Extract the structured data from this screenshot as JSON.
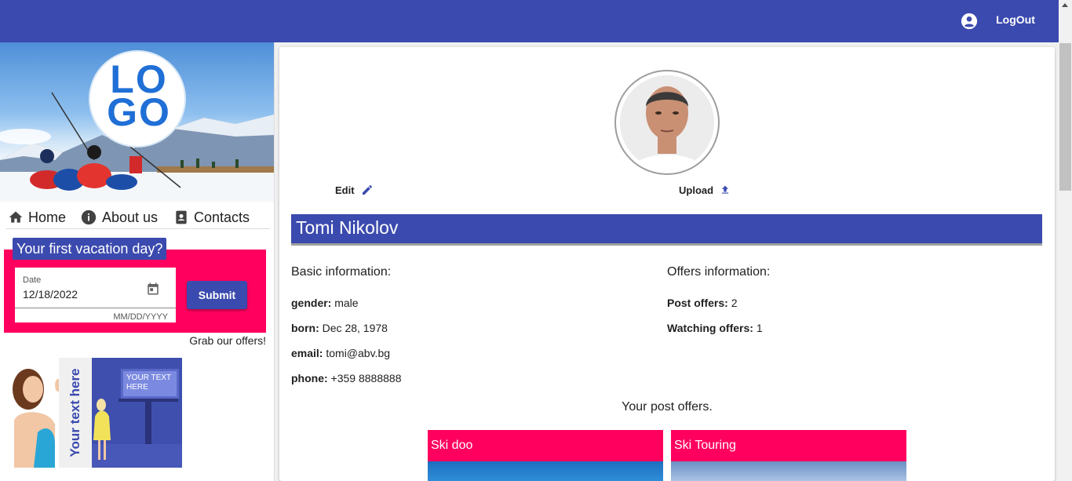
{
  "header": {
    "account_icon": "account-circle-icon",
    "logout_label": "LogOut",
    "bar_color": "#3b4aae"
  },
  "sidebar": {
    "logo_text": "LOGO",
    "nav": [
      {
        "label": "Home",
        "icon": "home-icon"
      },
      {
        "label": "About us",
        "icon": "info-icon"
      },
      {
        "label": "Contacts",
        "icon": "contacts-icon"
      }
    ],
    "vacation": {
      "title": "Your first vacation day?",
      "date_label": "Date",
      "date_value": "12/18/2022",
      "date_hint": "MM/DD/YYYY",
      "submit_label": "Submit",
      "accent_color": "#ff005e"
    },
    "grab_offers": "Grab our offers!",
    "ad": {
      "vertical_text": "Your text here",
      "board_text": "YOUR TEXT HERE"
    }
  },
  "profile": {
    "edit_label": "Edit",
    "upload_label": "Upload",
    "name": "Tomi Nikolov",
    "basic": {
      "heading": "Basic information:",
      "gender_label": "gender:",
      "gender": "male",
      "born_label": "born:",
      "born": "Dec 28, 1978",
      "email_label": "email:",
      "email": "tomi@abv.bg",
      "phone_label": "phone:",
      "phone": "+359 8888888"
    },
    "offers": {
      "heading": "Offers information:",
      "post_label": "Post offers:",
      "post": "2",
      "watching_label": "Watching offers:",
      "watching": "1"
    },
    "post_offers_heading": "Your post offers.",
    "cards": [
      {
        "title": "Ski doo"
      },
      {
        "title": "Ski Touring"
      }
    ]
  }
}
